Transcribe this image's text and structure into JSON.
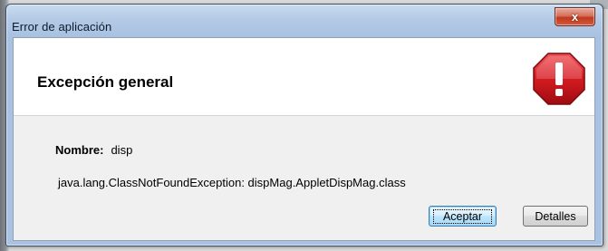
{
  "window": {
    "title": "Error de aplicación",
    "close_label": "x"
  },
  "header": {
    "title": "Excepción general",
    "icon": "error-stop-icon",
    "icon_color": "#c8141b"
  },
  "body": {
    "name_label": "Nombre:",
    "name_value": "disp",
    "exception": "java.lang.ClassNotFoundException: dispMag.AppletDispMag.class"
  },
  "buttons": {
    "accept_label": "Aceptar",
    "details_label": "Detalles"
  }
}
